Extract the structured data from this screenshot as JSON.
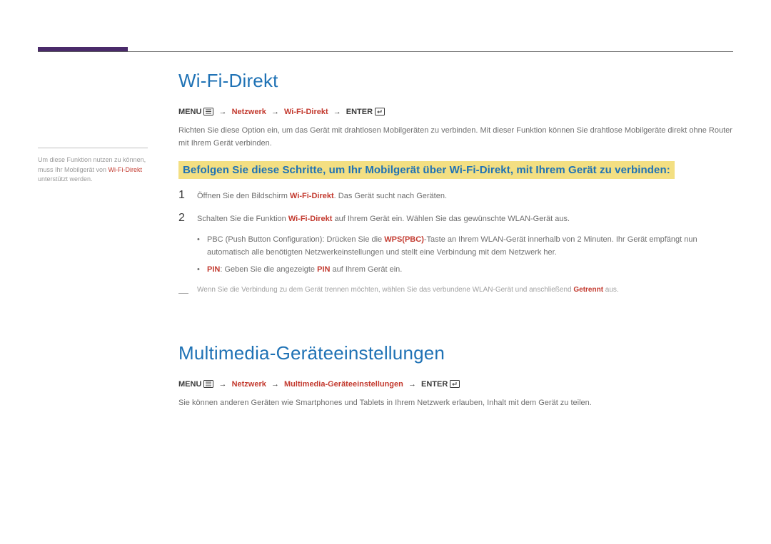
{
  "sidebar": {
    "note_pre": "Um diese Funktion nutzen zu können, muss Ihr Mobilgerät von ",
    "note_kw": "Wi-Fi-Direkt",
    "note_post": " unterstützt werden."
  },
  "section1": {
    "title": "Wi-Fi-Direkt",
    "path_menu": "MENU",
    "path_seg1": "Netzwerk",
    "path_seg2": "Wi-Fi-Direkt",
    "path_enter": "ENTER",
    "arrow": "→",
    "intro": "Richten Sie diese Option ein, um das Gerät mit drahtlosen Mobilgeräten zu verbinden. Mit dieser Funktion können Sie drahtlose Mobilgeräte direkt ohne Router mit Ihrem Gerät verbinden.",
    "highlight": "Befolgen Sie diese Schritte, um Ihr Mobilgerät über Wi-Fi-Direkt, mit Ihrem Gerät zu verbinden:",
    "step1_num": "1",
    "step1_pre": "Öffnen Sie den Bildschirm ",
    "step1_kw": "Wi-Fi-Direkt",
    "step1_post": ". Das Gerät sucht nach Geräten.",
    "step2_num": "2",
    "step2_pre": "Schalten Sie die Funktion ",
    "step2_kw": "Wi-Fi-Direkt",
    "step2_post": " auf Ihrem Gerät ein. Wählen Sie das gewünschte WLAN-Gerät aus.",
    "sub1_pre": "PBC (Push Button Configuration): Drücken Sie die ",
    "sub1_kw": "WPS(PBC)",
    "sub1_post": "-Taste an Ihrem WLAN-Gerät innerhalb von 2 Minuten. Ihr Gerät empfängt nun automatisch alle benötigten Netzwerkeinstellungen und stellt eine Verbindung mit dem Netzwerk her.",
    "sub2_kw1": "PIN",
    "sub2_mid": ": Geben Sie die angezeigte ",
    "sub2_kw2": "PIN",
    "sub2_post": " auf Ihrem Gerät ein.",
    "note_dash": "―",
    "note_pre": "Wenn Sie die Verbindung zu dem Gerät trennen möchten, wählen Sie das verbundene WLAN-Gerät und anschließend ",
    "note_kw": "Getrennt",
    "note_post": " aus.",
    "bullet": "•"
  },
  "section2": {
    "title": "Multimedia-Geräteeinstellungen",
    "path_menu": "MENU",
    "path_seg1": "Netzwerk",
    "path_seg2": "Multimedia-Geräteeinstellungen",
    "path_enter": "ENTER",
    "arrow": "→",
    "intro": "Sie können anderen Geräten wie Smartphones und Tablets in Ihrem Netzwerk erlauben, Inhalt mit dem Gerät zu teilen."
  }
}
